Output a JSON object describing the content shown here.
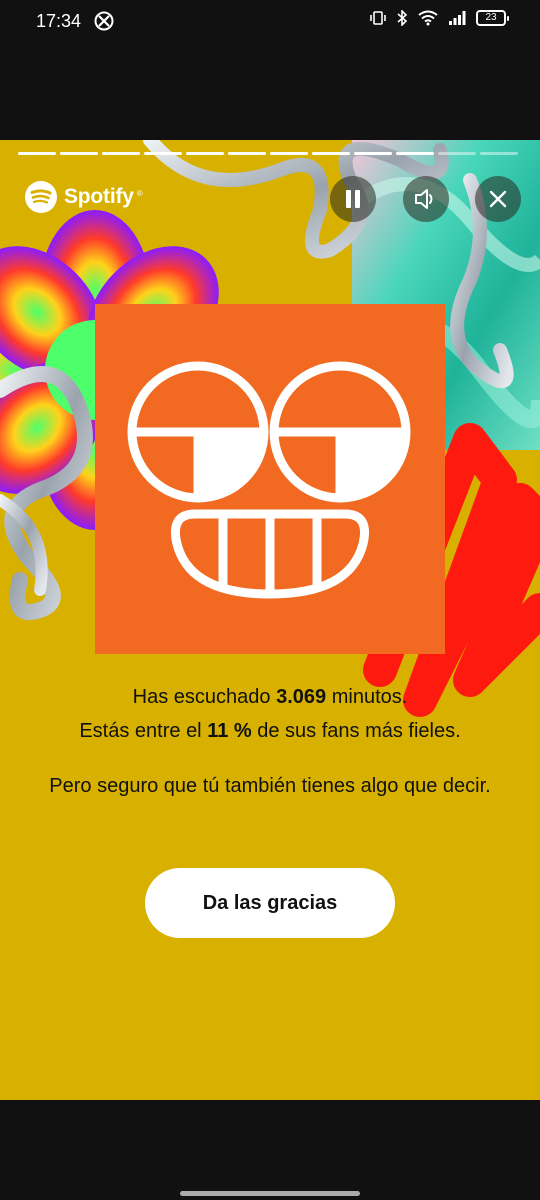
{
  "status_bar": {
    "time": "17:34",
    "left_icon": "xbox-icon",
    "right_icons": [
      "vibrate-icon",
      "bluetooth-icon",
      "wifi-icon",
      "signal-icon"
    ],
    "battery": "23"
  },
  "story": {
    "progress_segments": 12,
    "progress_completed": 10,
    "brand": "Spotify",
    "brand_mark": "®",
    "controls": [
      "pause-icon",
      "volume-icon",
      "close-icon"
    ],
    "message": {
      "line1_prefix": "Has escuchado ",
      "line1_value": "3.069",
      "line1_suffix": " minutos.",
      "line2_prefix": "Estás entre el ",
      "line2_value": "11 %",
      "line2_suffix": " de sus fans más fieles.",
      "line3": "Pero seguro que tú también tienes algo que decir."
    },
    "cta_label": "Da las gracias",
    "colors": {
      "background": "#d8b100",
      "cover": "#f26a22",
      "teal_art": "#3ccfb4",
      "red_art": "#ff1a10"
    }
  }
}
